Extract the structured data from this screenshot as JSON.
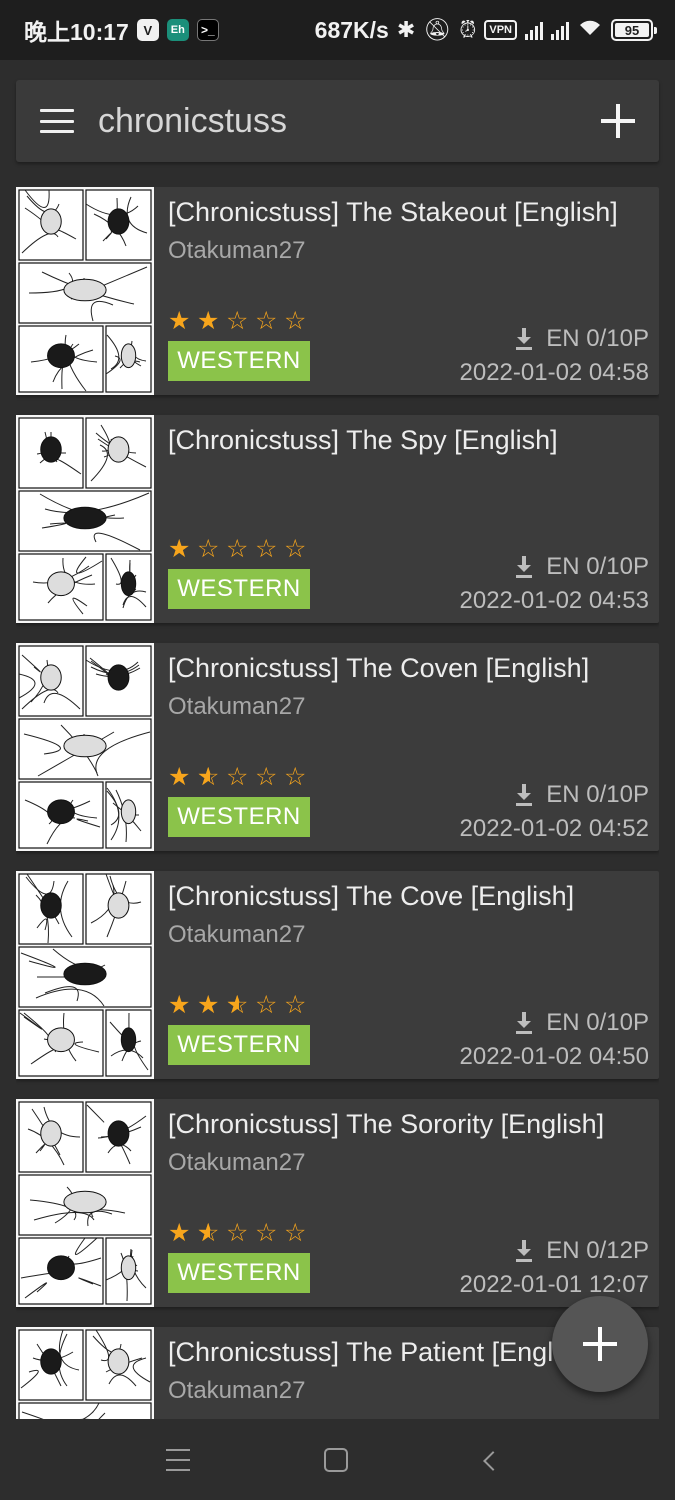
{
  "status_bar": {
    "time": "晚上10:17",
    "app_icons": [
      "V",
      "Eh",
      ">_"
    ],
    "net_speed": "687K/s",
    "icons": [
      "bluetooth-icon",
      "bell-muted-icon",
      "alarm-icon",
      "vpn-icon",
      "signal-hd-icon",
      "signal-hd-icon",
      "wifi-icon"
    ],
    "vpn_label": "VPN",
    "battery": "95"
  },
  "search": {
    "query": "chronicstuss"
  },
  "galleries": [
    {
      "title": "[Chronicstuss] The Stakeout [English]",
      "uploader": "Otakuman27",
      "rating": 2,
      "category": "WESTERN",
      "language_pages": "EN 0/10P",
      "date": "2022-01-02 04:58"
    },
    {
      "title": "[Chronicstuss] The Spy [English]",
      "uploader": "",
      "rating": 1,
      "category": "WESTERN",
      "language_pages": "EN 0/10P",
      "date": "2022-01-02 04:53"
    },
    {
      "title": "[Chronicstuss] The Coven [English]",
      "uploader": "Otakuman27",
      "rating": 1.5,
      "category": "WESTERN",
      "language_pages": "EN 0/10P",
      "date": "2022-01-02 04:52"
    },
    {
      "title": "[Chronicstuss] The Cove [English]",
      "uploader": "Otakuman27",
      "rating": 2.5,
      "category": "WESTERN",
      "language_pages": "EN 0/10P",
      "date": "2022-01-02 04:50"
    },
    {
      "title": "[Chronicstuss] The Sorority [English]",
      "uploader": "Otakuman27",
      "rating": 1.5,
      "category": "WESTERN",
      "language_pages": "EN 0/12P",
      "date": "2022-01-01 12:07"
    },
    {
      "title": "[Chronicstuss] The Patient [English]",
      "uploader": "Otakuman27",
      "rating": null,
      "category": "",
      "language_pages": "",
      "date": ""
    }
  ],
  "colors": {
    "background": "#2d2d2d",
    "card": "#3c3c3c",
    "star": "#f7a51c",
    "category_western": "#8bc34a",
    "fab": "#555555"
  }
}
